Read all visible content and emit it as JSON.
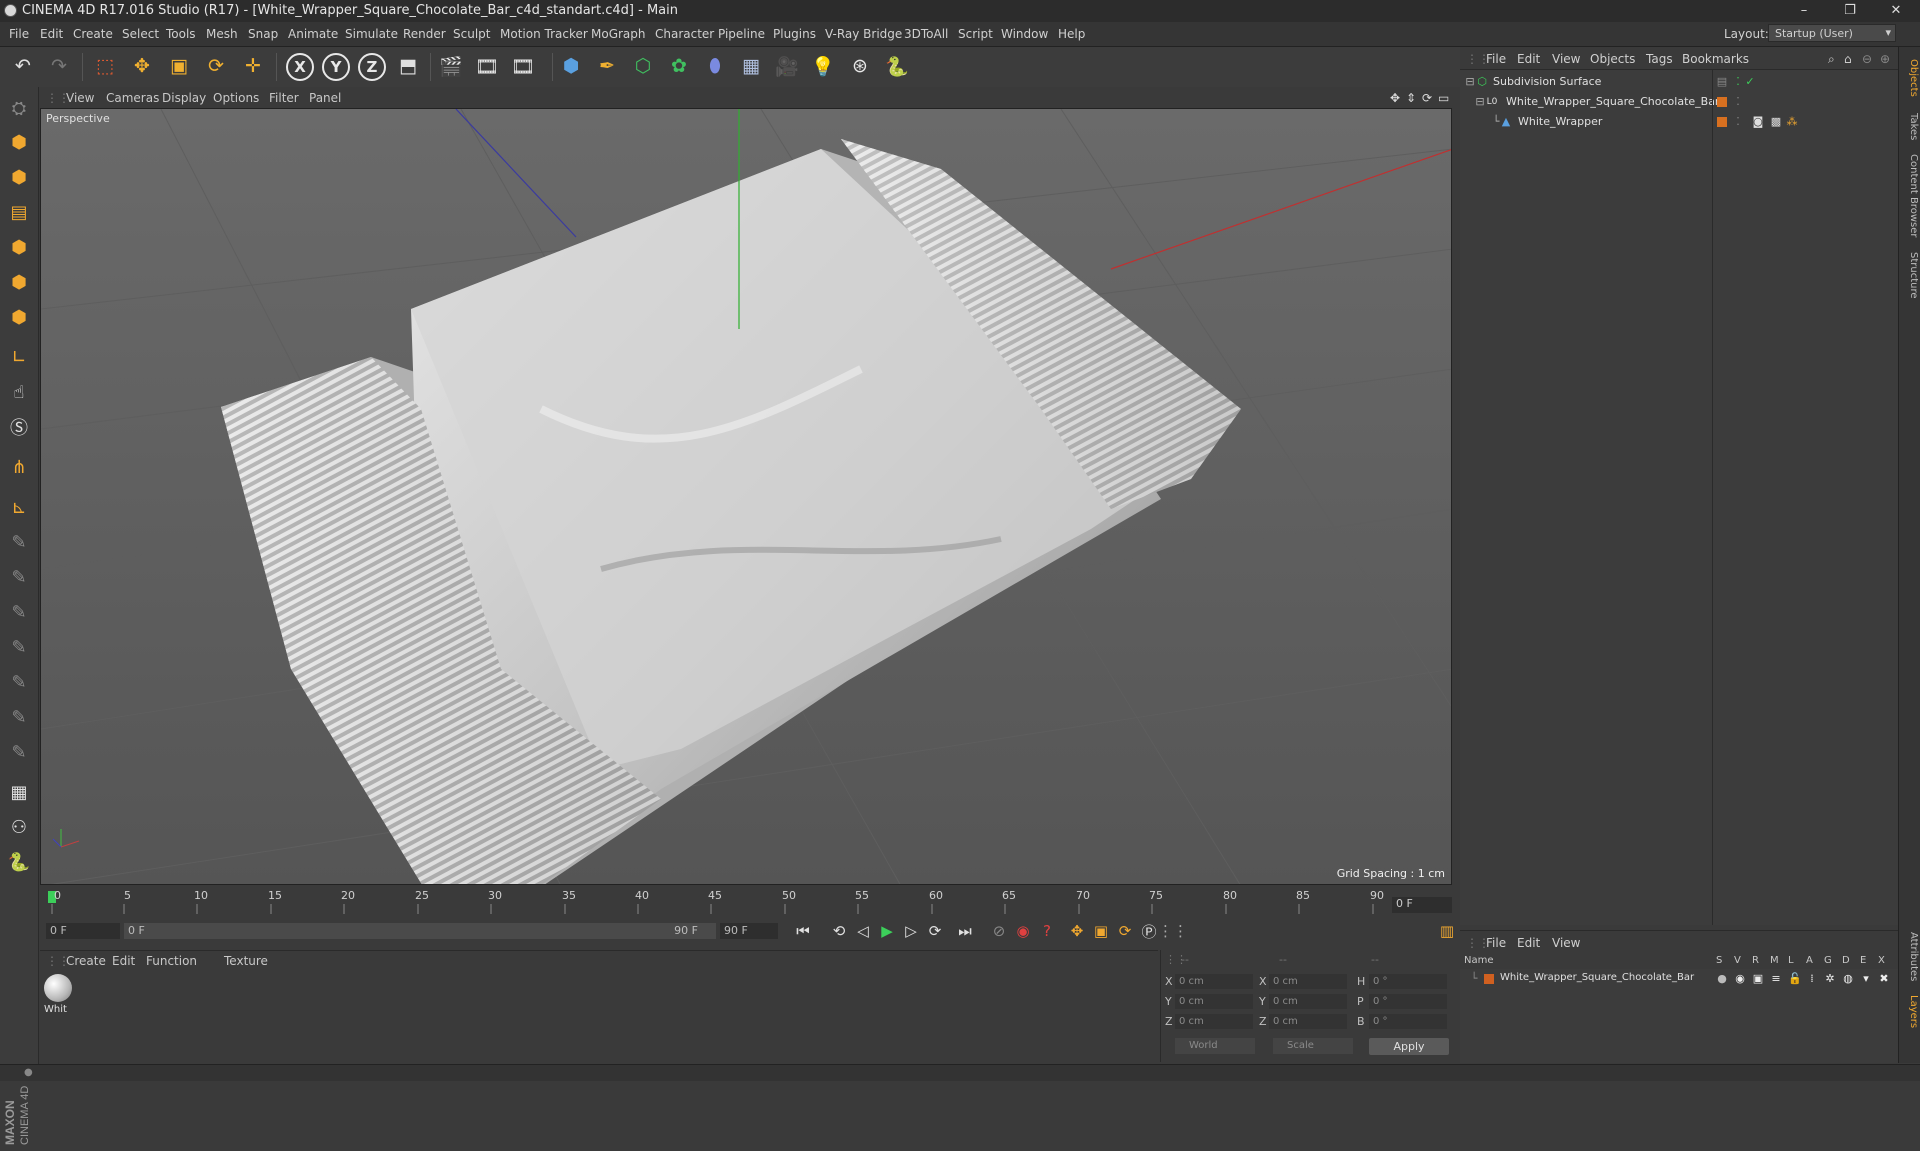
{
  "window": {
    "title": "CINEMA 4D R17.016 Studio (R17) - [White_Wrapper_Square_Chocolate_Bar_c4d_standart.c4d] - Main",
    "minimize": "–",
    "restore": "❐",
    "close": "✕"
  },
  "menubar": {
    "items": [
      "File",
      "Edit",
      "Create",
      "Select",
      "Tools",
      "Mesh",
      "Snap",
      "Animate",
      "Simulate",
      "Render",
      "Sculpt",
      "Motion Tracker",
      "MoGraph",
      "Character",
      "Pipeline",
      "Plugins",
      "V-Ray Bridge",
      "3DToAll",
      "Script",
      "Window",
      "Help"
    ],
    "layout_label": "Layout:",
    "layout_value": "Startup (User)"
  },
  "toolbar": {
    "axis_x": "X",
    "axis_y": "Y",
    "axis_z": "Z"
  },
  "viewport": {
    "menu": [
      "View",
      "Cameras",
      "Display",
      "Options",
      "Filter",
      "Panel"
    ],
    "label": "Perspective",
    "grid_spacing": "Grid Spacing : 1 cm"
  },
  "timeline": {
    "ticks": [
      "0",
      "5",
      "10",
      "15",
      "20",
      "25",
      "30",
      "35",
      "40",
      "45",
      "50",
      "55",
      "60",
      "65",
      "70",
      "75",
      "80",
      "85",
      "90"
    ],
    "current_frame": "0 F"
  },
  "playback": {
    "start_field": "0 F",
    "range_start": "0 F",
    "range_end": "90 F",
    "end_field": "90 F"
  },
  "material_manager": {
    "menu": [
      "Create",
      "Edit",
      "Function",
      "Texture"
    ],
    "material_name": "Whit"
  },
  "coordinates": {
    "header_left": "--",
    "header_mid": "--",
    "header_right": "--",
    "rows": [
      {
        "a": "X",
        "av": "0 cm",
        "b": "X",
        "bv": "0 cm",
        "c": "H",
        "cv": "0 °"
      },
      {
        "a": "Y",
        "av": "0 cm",
        "b": "Y",
        "bv": "0 cm",
        "c": "P",
        "cv": "0 °"
      },
      {
        "a": "Z",
        "av": "0 cm",
        "b": "Z",
        "bv": "0 cm",
        "c": "B",
        "cv": "0 °"
      }
    ],
    "mode1": "World",
    "mode2": "Scale",
    "apply": "Apply"
  },
  "object_manager": {
    "menu": [
      "File",
      "Edit",
      "View",
      "Objects",
      "Tags",
      "Bookmarks"
    ],
    "objects": [
      {
        "name": "Subdivision Surface"
      },
      {
        "name": "White_Wrapper_Square_Chocolate_Bar"
      },
      {
        "name": "White_Wrapper"
      }
    ]
  },
  "layer_manager": {
    "menu": [
      "File",
      "Edit",
      "View"
    ],
    "name_header": "Name",
    "columns": [
      "S",
      "V",
      "R",
      "M",
      "L",
      "A",
      "G",
      "D",
      "E",
      "X"
    ],
    "layers": [
      {
        "name": "White_Wrapper_Square_Chocolate_Bar",
        "color": "#d06020"
      }
    ]
  },
  "right_tabs": [
    "Objects",
    "Takes",
    "Content Browser",
    "Structure",
    "Attributes",
    "Layers"
  ],
  "brand": {
    "maxon": "MAXON",
    "c4d": "CINEMA 4D"
  },
  "colors": {
    "accent": "#f0a830",
    "tag_orange": "#d87020",
    "active_green": "#3ccf5a"
  }
}
